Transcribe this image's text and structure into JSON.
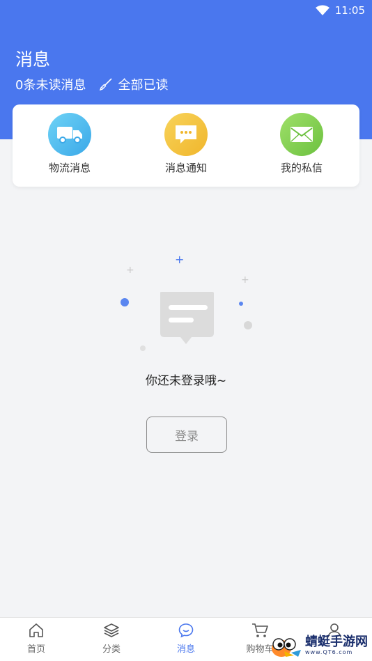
{
  "status_bar": {
    "time": "11:05"
  },
  "header": {
    "title": "消息",
    "unread_text": "0条未读消息",
    "mark_all_read": "全部已读"
  },
  "categories": [
    {
      "label": "物流消息",
      "icon": "truck-icon",
      "color": "#4fc3f7"
    },
    {
      "label": "消息通知",
      "icon": "chat-bubble-icon",
      "color": "#f5c542"
    },
    {
      "label": "我的私信",
      "icon": "envelope-icon",
      "color": "#8bd45a"
    }
  ],
  "empty_state": {
    "message": "你还未登录哦~",
    "login_button": "登录"
  },
  "tabbar": {
    "tabs": [
      {
        "label": "首页",
        "icon": "home-icon"
      },
      {
        "label": "分类",
        "icon": "layers-icon"
      },
      {
        "label": "消息",
        "icon": "message-icon",
        "active": true
      },
      {
        "label": "购物车",
        "icon": "cart-icon"
      },
      {
        "label": "",
        "icon": "user-icon"
      }
    ]
  },
  "watermark": {
    "name": "蜻蜓手游网",
    "url": "www.QT6.com"
  },
  "colors": {
    "primary": "#4a77ee",
    "background": "#f3f4f6"
  }
}
